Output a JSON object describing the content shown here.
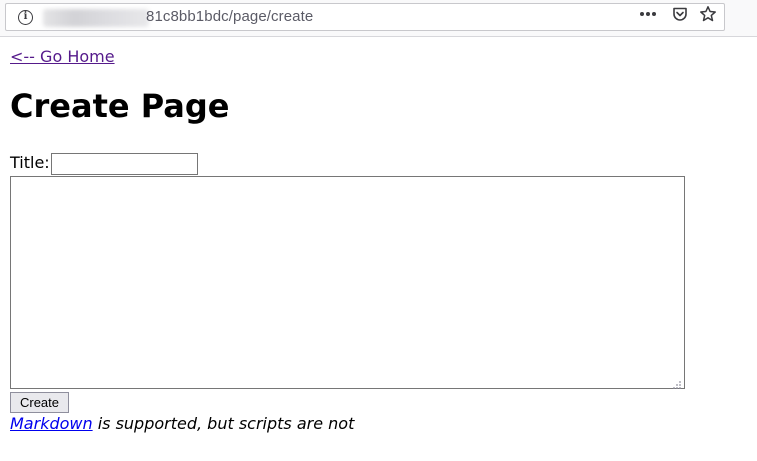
{
  "browser": {
    "url_visible": "81c8bb1bdc/page/create",
    "icons": {
      "info": "info-icon",
      "more": "more-icon",
      "pocket": "pocket-icon",
      "bookmark": "star-icon"
    }
  },
  "page": {
    "home_link": "<-- Go Home",
    "heading": "Create Page",
    "title_label": "Title:",
    "title_value": "",
    "content_value": "",
    "create_button": "Create",
    "footnote": {
      "link_text": "Markdown",
      "rest_text": " is supported, but scripts are not"
    }
  },
  "colors": {
    "visited_link": "#551a8b",
    "link": "#0000ee",
    "toolbar_bg": "#f9f9fa"
  }
}
